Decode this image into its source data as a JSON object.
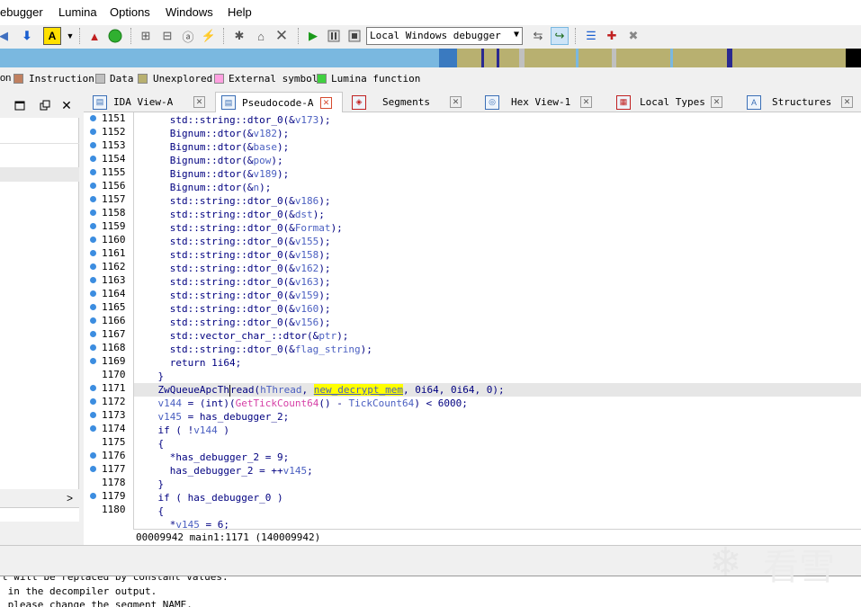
{
  "menu": [
    "ebugger",
    "Lumina",
    "Options",
    "Windows",
    "Help"
  ],
  "toolbar": {
    "debugger_select": "Local Windows debugger"
  },
  "colors": {
    "instruction": "#c08060",
    "data": "#c0c0c0",
    "unexplored": "#b8b070",
    "external": "#ffa0e0",
    "lumina": "#40d040",
    "function_blue": "#7ab8e0",
    "highlight": "#ffff00"
  },
  "legend": {
    "partial": "on",
    "instruction": "Instruction",
    "data": "Data",
    "unexplored": "Unexplored",
    "external": "External symbol",
    "lumina": "Lumina function"
  },
  "left_panel": {
    "scroll_right": ">"
  },
  "tabs": [
    {
      "label": "IDA View-A",
      "icon": "ida-view-icon",
      "active": false
    },
    {
      "label": "Pseudocode-A",
      "icon": "pseudocode-icon",
      "active": true
    },
    {
      "label": "Segments",
      "icon": "segments-icon",
      "active": false
    },
    {
      "label": "Hex View-1",
      "icon": "hex-view-icon",
      "active": false
    },
    {
      "label": "Local Types",
      "icon": "local-types-icon",
      "active": false
    },
    {
      "label": "Structures",
      "icon": "structures-icon",
      "active": false
    }
  ],
  "code_lines": [
    {
      "num": "1151",
      "dot": true,
      "text": "    std::string::dtor_0(&v173);"
    },
    {
      "num": "1152",
      "dot": true,
      "text": "    Bignum::dtor(&v182);"
    },
    {
      "num": "1153",
      "dot": true,
      "text": "    Bignum::dtor(&base);"
    },
    {
      "num": "1154",
      "dot": true,
      "text": "    Bignum::dtor(&pow);"
    },
    {
      "num": "1155",
      "dot": true,
      "text": "    Bignum::dtor(&v189);"
    },
    {
      "num": "1156",
      "dot": true,
      "text": "    Bignum::dtor(&n);"
    },
    {
      "num": "1157",
      "dot": true,
      "text": "    std::string::dtor_0(&v186);"
    },
    {
      "num": "1158",
      "dot": true,
      "text": "    std::string::dtor_0(&dst);"
    },
    {
      "num": "1159",
      "dot": true,
      "text": "    std::string::dtor_0(&Format);"
    },
    {
      "num": "1160",
      "dot": true,
      "text": "    std::string::dtor_0(&v155);"
    },
    {
      "num": "1161",
      "dot": true,
      "text": "    std::string::dtor_0(&v158);"
    },
    {
      "num": "1162",
      "dot": true,
      "text": "    std::string::dtor_0(&v162);"
    },
    {
      "num": "1163",
      "dot": true,
      "text": "    std::string::dtor_0(&v163);"
    },
    {
      "num": "1164",
      "dot": true,
      "text": "    std::string::dtor_0(&v159);"
    },
    {
      "num": "1165",
      "dot": true,
      "text": "    std::string::dtor_0(&v160);"
    },
    {
      "num": "1166",
      "dot": true,
      "text": "    std::string::dtor_0(&v156);"
    },
    {
      "num": "1167",
      "dot": true,
      "text": "    std::vector_char_::dtor(&ptr);"
    },
    {
      "num": "1168",
      "dot": true,
      "text": "    std::string::dtor_0(&flag_string);"
    },
    {
      "num": "1169",
      "dot": true,
      "text": "    return 1i64;"
    },
    {
      "num": "1170",
      "dot": false,
      "text": "  }"
    },
    {
      "num": "1171",
      "dot": true,
      "text": "  ZwQueueApcThread(hThread, new_decrypt_mem, 0i64, 0i64, 0);"
    },
    {
      "num": "1172",
      "dot": true,
      "text": "  v144 = (int)(GetTickCount64() - TickCount64) < 6000;"
    },
    {
      "num": "1173",
      "dot": true,
      "text": "  v145 = has_debugger_2;"
    },
    {
      "num": "1174",
      "dot": true,
      "text": "  if ( !v144 )"
    },
    {
      "num": "1175",
      "dot": false,
      "text": "  {"
    },
    {
      "num": "1176",
      "dot": true,
      "text": "    *has_debugger_2 = 9;"
    },
    {
      "num": "1177",
      "dot": true,
      "text": "    has_debugger_2 = ++v145;"
    },
    {
      "num": "1178",
      "dot": false,
      "text": "  }"
    },
    {
      "num": "1179",
      "dot": true,
      "text": "  if ( has_debugger_0 )"
    },
    {
      "num": "1180",
      "dot": false,
      "text": "  {"
    },
    {
      "num": "",
      "dot": false,
      "text": "    *v145 = 6;"
    }
  ],
  "status_line": "00009942 main1:1171 (140009942)",
  "output_lines": [
    "t will be replaced by constant values.",
    " in the decompiler output.",
    " please change the segment NAME."
  ],
  "watermark": "看雪"
}
